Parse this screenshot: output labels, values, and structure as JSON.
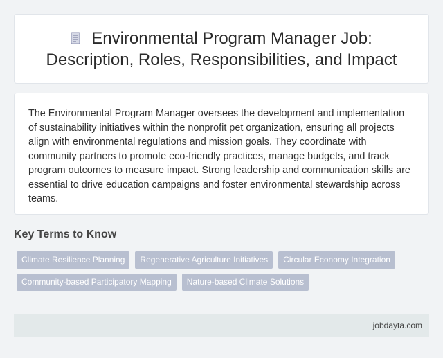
{
  "header": {
    "icon": "document-icon",
    "title": "Environmental Program Manager Job: Description, Roles, Responsibilities, and Impact"
  },
  "description": "The Environmental Program Manager oversees the development and implementation of sustainability initiatives within the nonprofit pet organization, ensuring all projects align with environmental regulations and mission goals. They coordinate with community partners to promote eco-friendly practices, manage budgets, and track program outcomes to measure impact. Strong leadership and communication skills are essential to drive education campaigns and foster environmental stewardship across teams.",
  "key_terms": {
    "heading": "Key Terms to Know",
    "tags": [
      "Climate Resilience Planning",
      "Regenerative Agriculture Initiatives",
      "Circular Economy Integration",
      "Community-based Participatory Mapping",
      "Nature-based Climate Solutions"
    ]
  },
  "footer": {
    "site": "jobdayta.com"
  },
  "colors": {
    "tag_bg": "#b8bfd0",
    "footer_bg": "#e3e9ea",
    "page_bg": "#f1f3f5"
  }
}
